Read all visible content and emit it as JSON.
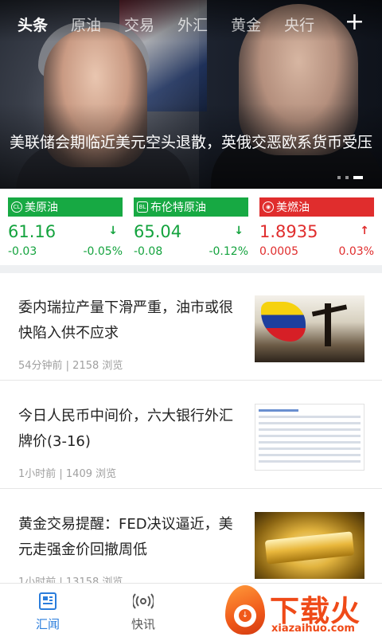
{
  "tabs": [
    "头条",
    "原油",
    "交易",
    "外汇",
    "黄金",
    "央行"
  ],
  "tab_add_label": "+",
  "hero": {
    "headline": "美联储会期临近美元空头退散，英俄交恶欧系货币受压"
  },
  "tickers": [
    {
      "badge": "CL",
      "name": "美原油",
      "price": "61.16",
      "arrow": "↓",
      "change": "-0.03",
      "percent": "-0.05%",
      "color": "#17a943"
    },
    {
      "badge": "BL",
      "name": "布伦特原油",
      "price": "65.04",
      "arrow": "↓",
      "change": "-0.08",
      "percent": "-0.12%",
      "color": "#17a943"
    },
    {
      "badge": "◉",
      "name": "美燃油",
      "price": "1.8935",
      "arrow": "↑",
      "change": "0.0005",
      "percent": "0.03%",
      "color": "#e02d2d"
    }
  ],
  "news": [
    {
      "title": "委内瑞拉产量下滑严重，油市或很快陷入供不应求",
      "meta": "54分钟前 | 2158 浏览"
    },
    {
      "title": "今日人民币中间价，六大银行外汇牌价(3-16)",
      "meta": "1小时前 | 1409 浏览"
    },
    {
      "title": "黄金交易提醒：FED决议逼近，美元走强金价回撤周低",
      "meta": "1小时前 | 13158 浏览"
    }
  ],
  "bottom_nav": [
    {
      "label": "汇闻",
      "icon": "news-icon"
    },
    {
      "label": "快讯",
      "icon": "broadcast-icon"
    }
  ],
  "watermark": {
    "text": "下载火",
    "url": "xiazaihuo.com"
  },
  "colors": {
    "up": "#e02d2d",
    "down": "#17a943",
    "accent": "#2a7ddc"
  }
}
